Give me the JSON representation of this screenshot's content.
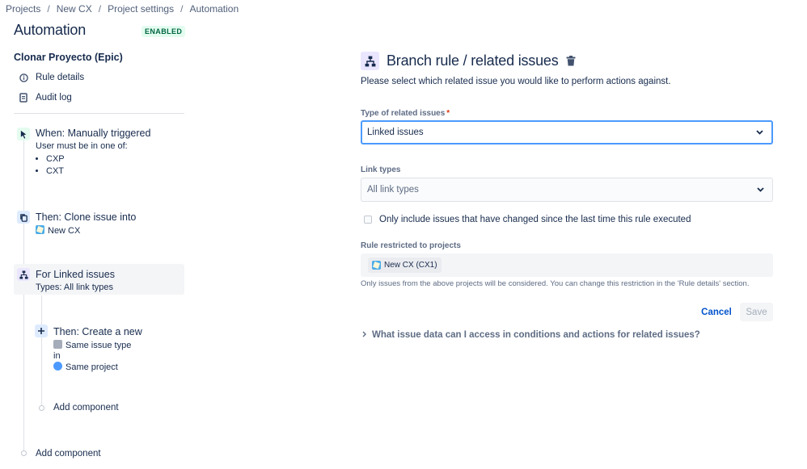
{
  "breadcrumbs": [
    "Projects",
    "New CX",
    "Project settings",
    "Automation"
  ],
  "page_title": "Automation",
  "status_badge": "ENABLED",
  "rule_name": "Clonar Proyecto (Epic)",
  "sidebar_links": {
    "rule_details": "Rule details",
    "audit_log": "Audit log"
  },
  "steps": {
    "trigger": {
      "title": "When: Manually triggered",
      "subtitle": "User must be in one of:",
      "groups": [
        "CXP",
        "CXT"
      ]
    },
    "clone": {
      "title": "Then: Clone issue into",
      "project": "New CX"
    },
    "branch": {
      "title": "For Linked issues",
      "subtitle": "Types: All link types"
    },
    "create": {
      "title": "Then: Create a new",
      "issue_type": "Same issue type",
      "in_text": "in",
      "project": "Same project"
    },
    "add_component_inner": "Add component",
    "add_component_outer": "Add component"
  },
  "panel": {
    "title": "Branch rule / related issues",
    "description": "Please select which related issue you would like to perform actions against.",
    "type_label": "Type of related issues",
    "required_mark": "*",
    "type_value": "Linked issues",
    "link_types_label": "Link types",
    "link_types_placeholder": "All link types",
    "checkbox_label": "Only include issues that have changed since the last time this rule executed",
    "restricted_label": "Rule restricted to projects",
    "restricted_project": "New CX (CX1)",
    "help_text": "Only issues from the above projects will be considered. You can change this restriction in the 'Rule details' section.",
    "cancel_label": "Cancel",
    "save_label": "Save",
    "expander_label": "What issue data can I access in conditions and actions for related issues?"
  },
  "colors": {
    "accent": "#0052cc",
    "focus_border": "#4c9aff",
    "enabled_bg": "#e3fcef",
    "enabled_text": "#006644",
    "branch_icon_bg": "#eae6ff"
  }
}
